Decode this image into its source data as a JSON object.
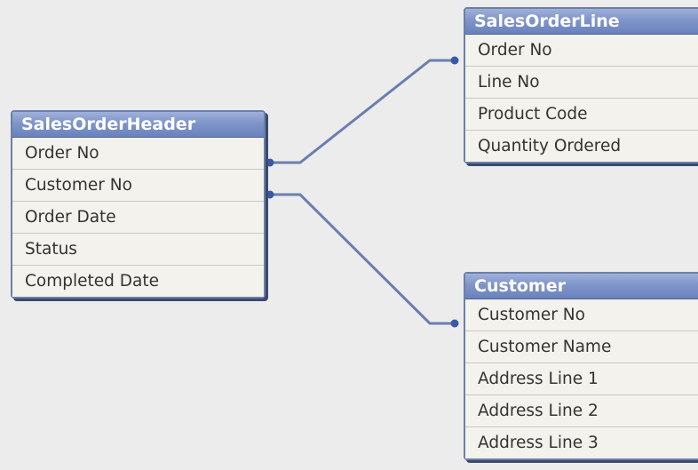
{
  "tables": {
    "sales_order_header": {
      "title": "SalesOrderHeader",
      "fields": [
        "Order No",
        "Customer No",
        "Order Date",
        "Status",
        "Completed Date"
      ]
    },
    "sales_order_line": {
      "title": "SalesOrderLine",
      "fields": [
        "Order No",
        "Line No",
        "Product Code",
        "Quantity Ordered"
      ]
    },
    "customer": {
      "title": "Customer",
      "fields": [
        "Customer No",
        "Customer Name",
        "Address Line 1",
        "Address Line 2",
        "Address Line 3"
      ]
    }
  },
  "relationships": [
    {
      "from_table": "SalesOrderHeader",
      "from_field": "Order No",
      "to_table": "SalesOrderLine",
      "to_field": "Order No"
    },
    {
      "from_table": "SalesOrderHeader",
      "from_field": "Customer No",
      "to_table": "Customer",
      "to_field": "Customer No"
    }
  ],
  "colors": {
    "background": "#ececec",
    "title_bar": "#7f95c9",
    "connector": "#6a7fb0",
    "connector_dot": "#3a58a8",
    "row_background": "#f3f2ec"
  }
}
